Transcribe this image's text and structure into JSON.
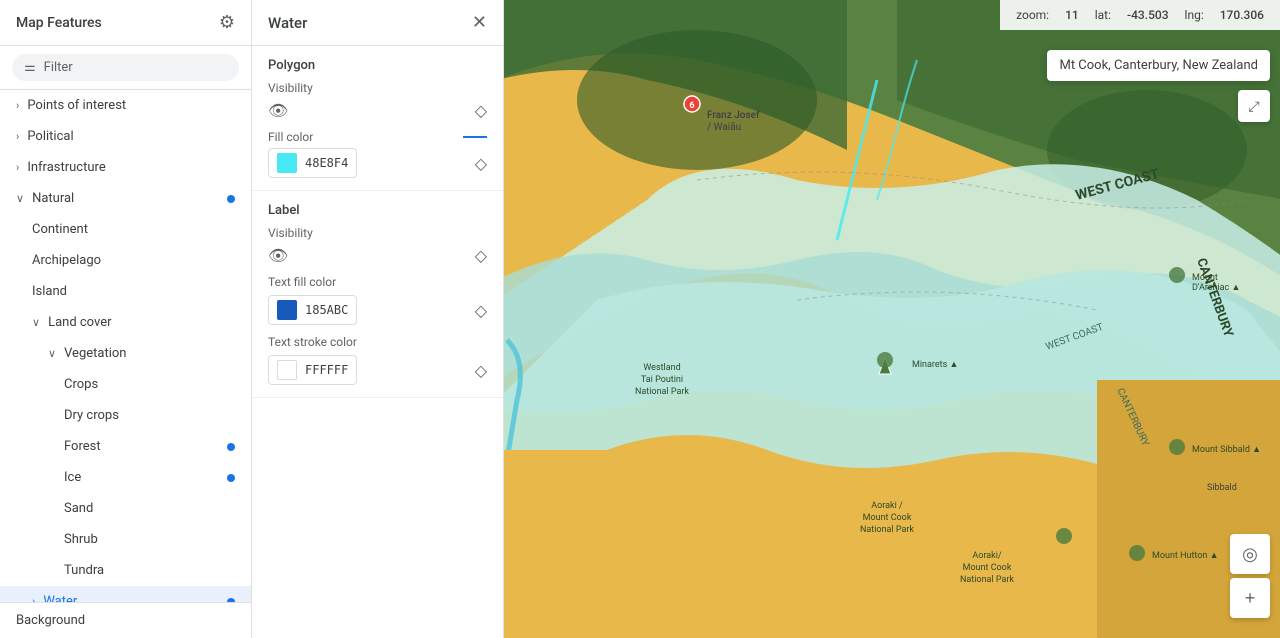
{
  "sidebar": {
    "title": "Map Features",
    "filter_placeholder": "Filter",
    "items": [
      {
        "id": "points-of-interest",
        "label": "Points of interest",
        "level": 0,
        "has_chevron": true,
        "has_dot": false
      },
      {
        "id": "political",
        "label": "Political",
        "level": 0,
        "has_chevron": true,
        "has_dot": false
      },
      {
        "id": "infrastructure",
        "label": "Infrastructure",
        "level": 0,
        "has_chevron": true,
        "has_dot": false
      },
      {
        "id": "natural",
        "label": "Natural",
        "level": 0,
        "has_chevron": true,
        "expanded": true,
        "has_dot": true
      },
      {
        "id": "continent",
        "label": "Continent",
        "level": 1,
        "has_chevron": false,
        "has_dot": false
      },
      {
        "id": "archipelago",
        "label": "Archipelago",
        "level": 1,
        "has_chevron": false,
        "has_dot": false
      },
      {
        "id": "island",
        "label": "Island",
        "level": 1,
        "has_chevron": false,
        "has_dot": false
      },
      {
        "id": "land-cover",
        "label": "Land cover",
        "level": 1,
        "has_chevron": true,
        "expanded": true,
        "has_dot": false
      },
      {
        "id": "vegetation",
        "label": "Vegetation",
        "level": 2,
        "has_chevron": true,
        "expanded": true,
        "has_dot": false
      },
      {
        "id": "crops",
        "label": "Crops",
        "level": 3,
        "has_chevron": false,
        "has_dot": false
      },
      {
        "id": "dry-crops",
        "label": "Dry crops",
        "level": 3,
        "has_chevron": false,
        "has_dot": false
      },
      {
        "id": "forest",
        "label": "Forest",
        "level": 3,
        "has_chevron": false,
        "has_dot": true
      },
      {
        "id": "ice",
        "label": "Ice",
        "level": 3,
        "has_chevron": false,
        "has_dot": true
      },
      {
        "id": "sand",
        "label": "Sand",
        "level": 3,
        "has_chevron": false,
        "has_dot": false
      },
      {
        "id": "shrub",
        "label": "Shrub",
        "level": 3,
        "has_chevron": false,
        "has_dot": false
      },
      {
        "id": "tundra",
        "label": "Tundra",
        "level": 3,
        "has_chevron": false,
        "has_dot": false
      },
      {
        "id": "water",
        "label": "Water",
        "level": 1,
        "has_chevron": true,
        "has_dot": true,
        "selected": true
      }
    ],
    "footer_item": "Background"
  },
  "detail_panel": {
    "title": "Water",
    "polygon_section": {
      "title": "Polygon",
      "visibility_label": "Visibility",
      "fill_color_label": "Fill color",
      "fill_color_value": "48E8F4",
      "fill_color_hex": "#48E8F4"
    },
    "label_section": {
      "title": "Label",
      "visibility_label": "Visibility",
      "text_fill_label": "Text fill color",
      "text_fill_value": "185ABC",
      "text_fill_hex": "#185ABC",
      "text_stroke_label": "Text stroke color",
      "text_stroke_value": "FFFFFF",
      "text_stroke_hex": "#FFFFFF"
    }
  },
  "map": {
    "zoom_label": "zoom:",
    "zoom_value": "11",
    "lat_label": "lat:",
    "lat_value": "-43.503",
    "lng_label": "lng:",
    "lng_value": "170.306",
    "location_tooltip": "Mt Cook, Canterbury, New Zealand"
  },
  "icons": {
    "gear": "⚙",
    "filter": "≡",
    "close": "✕",
    "eye": "👁",
    "diamond": "◇",
    "fullscreen": "⤢",
    "location": "◎",
    "plus": "+",
    "chevron_right": "›",
    "chevron_down": "∨"
  }
}
